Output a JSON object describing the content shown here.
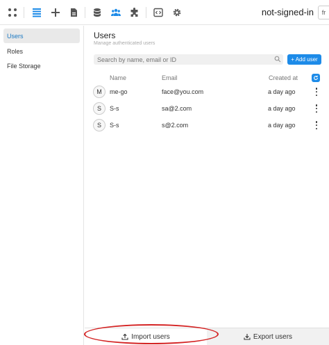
{
  "topbar": {
    "title": "not-signed-in",
    "language": "fr",
    "icons": [
      "apps-icon",
      "list-icon",
      "plus-icon",
      "document-icon",
      "database-icon",
      "users-icon",
      "plugin-icon",
      "code-icon",
      "gear-icon"
    ]
  },
  "sidebar": {
    "items": [
      {
        "label": "Users",
        "active": true
      },
      {
        "label": "Roles",
        "active": false
      },
      {
        "label": "File Storage",
        "active": false
      }
    ]
  },
  "main": {
    "title": "Users",
    "subtitle": "Manage authenticated users",
    "search_placeholder": "Search by name, email or ID",
    "add_label": "+ Add user",
    "columns": {
      "name": "Name",
      "email": "Email",
      "created": "Created at"
    },
    "rows": [
      {
        "initial": "M",
        "name": "me-go",
        "email": "face@you.com",
        "created": "a day ago"
      },
      {
        "initial": "S",
        "name": "S-s",
        "email": "sa@2.com",
        "created": "a day ago"
      },
      {
        "initial": "S",
        "name": "S-s",
        "email": "s@2.com",
        "created": "a day ago"
      }
    ],
    "import_label": "Import users",
    "export_label": "Export users"
  },
  "colors": {
    "accent": "#1d8be8",
    "highlight": "#d42424"
  }
}
